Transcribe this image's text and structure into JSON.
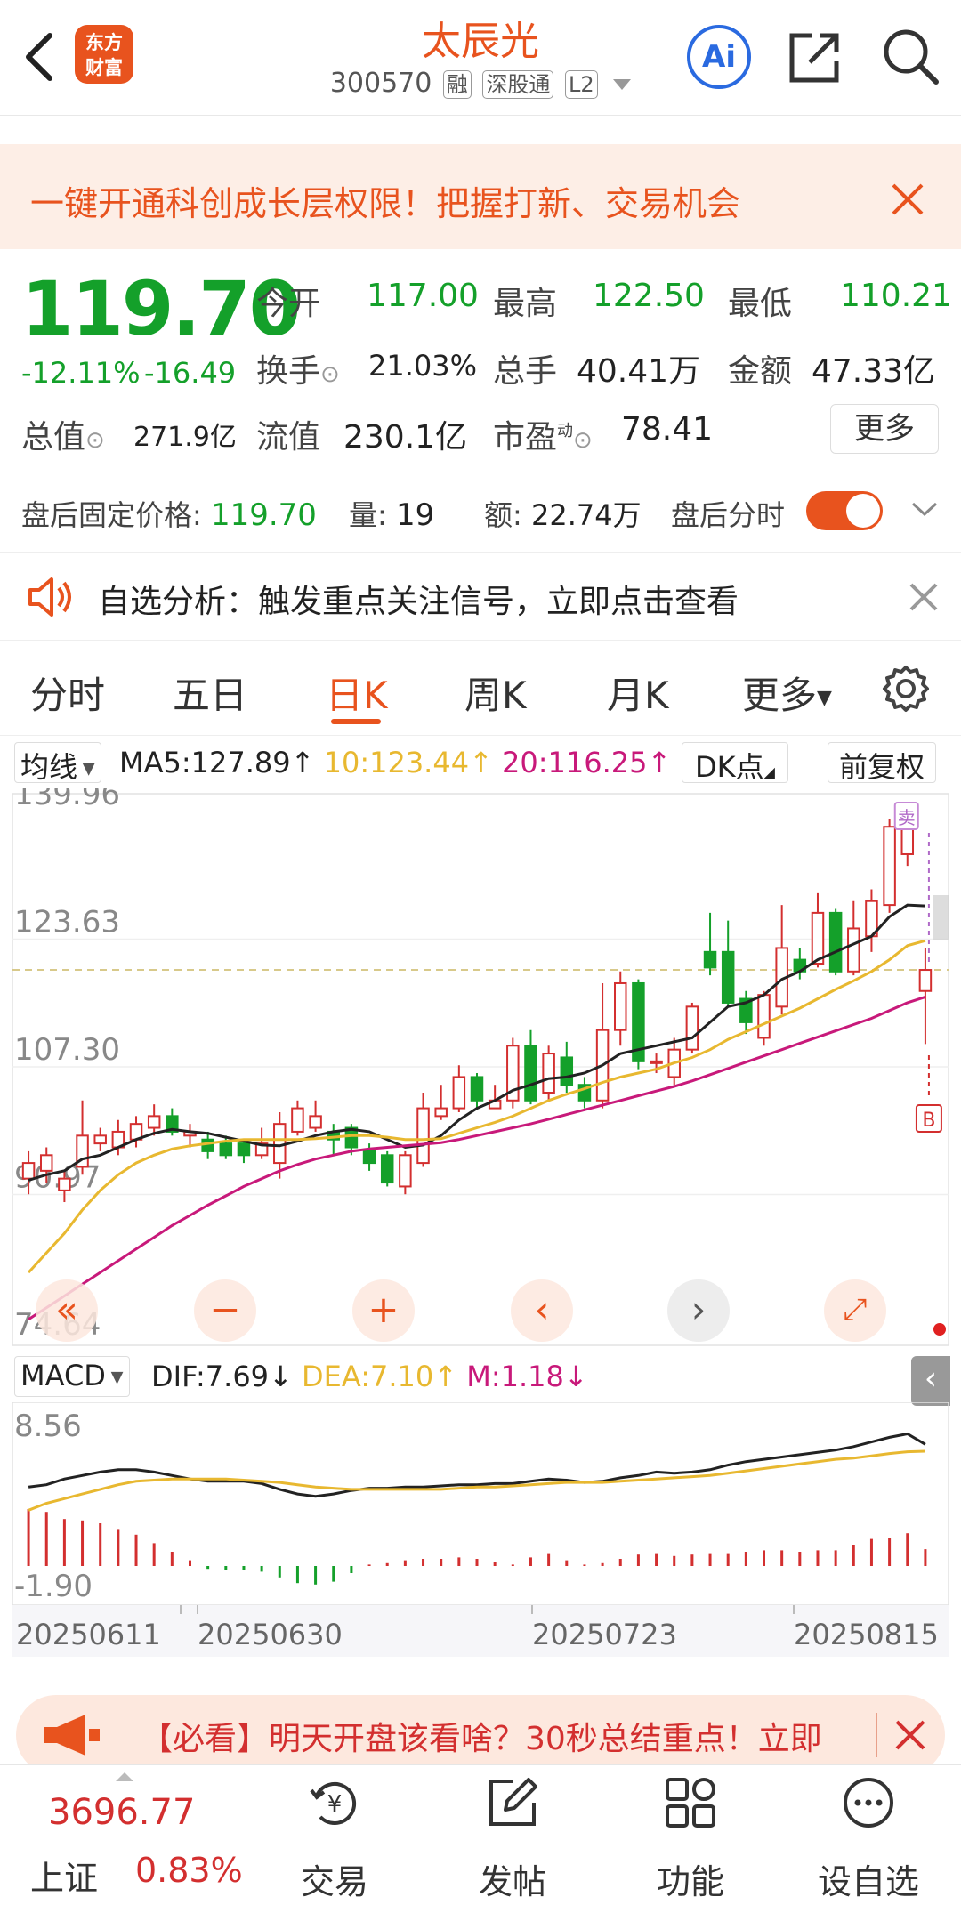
{
  "header": {
    "logo_line1": "东方",
    "logo_line2": "财富",
    "title": "太辰光",
    "code": "300570",
    "tags": [
      "融",
      "深股通",
      "L2"
    ],
    "ai_label": "Ai"
  },
  "banner": {
    "text": "一键开通科创成长层权限！把握打新、交易机会"
  },
  "quote": {
    "price": "119.70",
    "change_pct": "-12.11%",
    "change": "-16.49",
    "open_label": "今开",
    "open": "117.00",
    "high_label": "最高",
    "high": "122.50",
    "low_label": "最低",
    "low": "110.21",
    "turnover_label": "换手",
    "turnover": "21.03%",
    "volume_label": "总手",
    "volume": "40.41万",
    "amount_label": "金额",
    "amount": "47.33亿",
    "mktcap_label": "总值",
    "mktcap": "271.9亿",
    "float_label": "流值",
    "float_cap": "230.1亿",
    "pe_label": "市盈",
    "pe_sup": "动",
    "pe": "78.41",
    "more_label": "更多"
  },
  "after_hours": {
    "price_label": "盘后固定价格:",
    "price": "119.70",
    "vol_label": "量:",
    "vol": "19",
    "amt_label": "额:",
    "amt": "22.74万",
    "toggle_label": "盘后分时"
  },
  "notice": {
    "text": "自选分析：触发重点关注信号，立即点击查看"
  },
  "tabs": [
    "分时",
    "五日",
    "日K",
    "周K",
    "月K",
    "更多"
  ],
  "active_tab": 2,
  "ma_bar": {
    "selector": "均线",
    "ma5": "MA5:127.89↑",
    "ma10": "10:123.44↑",
    "ma20": "20:116.25↑",
    "dk": "DK点",
    "adjust": "前复权"
  },
  "macd_bar": {
    "selector": "MACD",
    "dif": "DIF:7.69↓",
    "dea": "DEA:7.10↑",
    "m": "M:1.18↓"
  },
  "colors": {
    "up": "#d32f2f",
    "down": "#14a02a",
    "accent": "#e8531e",
    "ma5": "#222222",
    "ma10": "#e8b830",
    "ma20": "#c8197a"
  },
  "chart_data": [
    {
      "type": "candlestick",
      "y_ticks": [
        "139.96",
        "123.63",
        "107.30",
        "90.97",
        "74.64"
      ],
      "ylim": [
        74.64,
        139.96
      ],
      "x_ticks": [
        "20250611",
        "20250630",
        "20250723",
        "20250815"
      ],
      "candles": [
        [
          93.0,
          95.0,
          91.0,
          96.5
        ],
        [
          94.0,
          96.0,
          92.5,
          97.0
        ],
        [
          91.5,
          93.0,
          90.0,
          94.0
        ],
        [
          94.5,
          98.5,
          93.5,
          103.0
        ],
        [
          97.5,
          98.5,
          96.5,
          99.5
        ],
        [
          97.0,
          99.0,
          96.0,
          100.5
        ],
        [
          98.0,
          100.0,
          97.0,
          101.0
        ],
        [
          99.5,
          101.0,
          98.5,
          102.5
        ],
        [
          101.0,
          99.0,
          98.5,
          102.0
        ],
        [
          98.5,
          99.0,
          97.0,
          100.0
        ],
        [
          98.0,
          96.5,
          95.5,
          99.0
        ],
        [
          97.5,
          96.0,
          95.5,
          98.5
        ],
        [
          97.5,
          96.0,
          95.0,
          98.0
        ],
        [
          96.0,
          97.5,
          95.5,
          99.5
        ],
        [
          95.0,
          100.0,
          93.0,
          101.5
        ],
        [
          99.0,
          102.0,
          98.5,
          103.0
        ],
        [
          99.5,
          101.0,
          99.0,
          103.0
        ],
        [
          99.0,
          98.0,
          96.0,
          100.0
        ],
        [
          99.5,
          97.0,
          96.0,
          100.0
        ],
        [
          96.5,
          95.0,
          94.0,
          97.5
        ],
        [
          96.0,
          92.5,
          92.0,
          96.5
        ],
        [
          92.0,
          96.0,
          91.0,
          96.5
        ],
        [
          95.0,
          102.0,
          94.5,
          104.0
        ],
        [
          101.0,
          102.0,
          100.5,
          105.0
        ],
        [
          102.0,
          106.0,
          101.5,
          107.5
        ],
        [
          106.0,
          103.0,
          102.0,
          106.5
        ],
        [
          102.0,
          103.0,
          102.0,
          105.0
        ],
        [
          103.0,
          110.0,
          102.0,
          111.0
        ],
        [
          110.0,
          103.0,
          102.5,
          112.0
        ],
        [
          104.0,
          109.0,
          103.0,
          110.0
        ],
        [
          108.5,
          105.0,
          104.0,
          110.5
        ],
        [
          105.0,
          103.0,
          102.0,
          106.0
        ],
        [
          103.0,
          112.0,
          102.0,
          118.0
        ],
        [
          112.0,
          118.0,
          110.0,
          119.5
        ],
        [
          118.0,
          108.0,
          107.0,
          118.5
        ],
        [
          108.0,
          108.0,
          106.5,
          109.0
        ],
        [
          106.0,
          109.5,
          105.0,
          111.0
        ],
        [
          109.5,
          115.0,
          109.0,
          115.5
        ],
        [
          122.0,
          120.0,
          119.0,
          127.0
        ],
        [
          122.0,
          115.5,
          115.0,
          126.0
        ],
        [
          116.0,
          113.0,
          111.5,
          117.0
        ],
        [
          111.0,
          116.5,
          110.0,
          117.0
        ],
        [
          115.0,
          122.5,
          114.0,
          128.0
        ],
        [
          121.0,
          119.5,
          118.5,
          122.5
        ],
        [
          120.5,
          127.0,
          120.0,
          129.5
        ],
        [
          127.0,
          119.5,
          119.0,
          127.5
        ],
        [
          119.5,
          125.0,
          119.0,
          128.5
        ],
        [
          124.0,
          128.5,
          122.0,
          130.0
        ],
        [
          128.0,
          138.0,
          127.0,
          139.0
        ],
        [
          134.5,
          138.5,
          133.0,
          141.0
        ],
        [
          117.0,
          119.7,
          110.21,
          122.5
        ]
      ],
      "ma_lines": {
        "ma5": [
          92.8,
          93.5,
          94.0,
          95.5,
          96.0,
          97.0,
          98.0,
          98.8,
          99.3,
          99.0,
          98.8,
          98.3,
          97.8,
          97.3,
          97.2,
          97.8,
          98.5,
          99.0,
          99.3,
          99.0,
          98.0,
          97.0,
          97.3,
          98.5,
          100.5,
          102.0,
          103.0,
          104.3,
          105.0,
          105.8,
          106.0,
          106.5,
          107.5,
          109.0,
          109.5,
          110.0,
          110.5,
          111.0,
          113.0,
          115.0,
          115.5,
          116.5,
          118.5,
          119.5,
          121.0,
          122.0,
          123.0,
          124.0,
          126.5,
          128.0,
          127.89
        ],
        "ma10": [
          81.0,
          83.5,
          86.0,
          89.0,
          91.5,
          93.5,
          95.0,
          96.0,
          96.8,
          97.2,
          97.5,
          97.8,
          98.0,
          98.0,
          98.0,
          98.0,
          98.1,
          98.3,
          98.5,
          98.5,
          98.3,
          98.0,
          98.0,
          98.1,
          98.8,
          99.5,
          100.2,
          101.0,
          102.0,
          103.0,
          103.8,
          104.5,
          105.3,
          106.0,
          106.5,
          107.0,
          107.8,
          108.5,
          109.5,
          110.8,
          111.8,
          112.8,
          113.8,
          114.8,
          116.0,
          117.2,
          118.3,
          119.5,
          121.0,
          122.8,
          123.44
        ],
        "ma20": [
          75.0,
          76.5,
          78.0,
          79.5,
          81.0,
          82.5,
          84.0,
          85.5,
          87.0,
          88.3,
          89.6,
          90.8,
          92.0,
          93.0,
          94.0,
          94.8,
          95.5,
          96.0,
          96.5,
          96.8,
          97.0,
          97.2,
          97.4,
          97.6,
          98.0,
          98.5,
          99.0,
          99.5,
          100.0,
          100.6,
          101.2,
          101.8,
          102.4,
          103.0,
          103.6,
          104.2,
          104.8,
          105.5,
          106.3,
          107.1,
          107.9,
          108.7,
          109.5,
          110.3,
          111.1,
          111.9,
          112.7,
          113.5,
          114.5,
          115.5,
          116.25
        ]
      },
      "reference_price": 119.7,
      "markers": [
        "B",
        "卖"
      ]
    },
    {
      "type": "bar+line",
      "y_ticks": [
        "8.56",
        "-1.90"
      ],
      "ylim": [
        -1.9,
        8.56
      ],
      "dif": [
        4.0,
        4.2,
        4.7,
        5.0,
        5.3,
        5.5,
        5.5,
        5.3,
        5.0,
        4.7,
        4.5,
        4.5,
        4.5,
        4.3,
        3.8,
        3.4,
        3.2,
        3.4,
        3.7,
        3.9,
        3.9,
        4.0,
        4.0,
        4.1,
        4.2,
        4.2,
        4.3,
        4.3,
        4.5,
        4.7,
        4.6,
        4.4,
        4.5,
        4.8,
        5.0,
        5.3,
        5.2,
        5.3,
        5.5,
        5.9,
        6.2,
        6.4,
        6.6,
        6.8,
        7.0,
        7.2,
        7.5,
        7.9,
        8.3,
        8.6,
        7.69
      ],
      "dea": [
        2.0,
        2.6,
        3.0,
        3.4,
        3.8,
        4.2,
        4.5,
        4.6,
        4.7,
        4.7,
        4.7,
        4.7,
        4.6,
        4.5,
        4.4,
        4.2,
        4.0,
        3.9,
        3.8,
        3.8,
        3.8,
        3.8,
        3.8,
        3.8,
        3.9,
        4.0,
        4.0,
        4.1,
        4.2,
        4.3,
        4.4,
        4.4,
        4.4,
        4.5,
        4.6,
        4.7,
        4.8,
        4.9,
        5.0,
        5.2,
        5.4,
        5.6,
        5.8,
        6.0,
        6.2,
        6.4,
        6.5,
        6.7,
        6.9,
        7.05,
        7.1
      ],
      "m": [
        4.0,
        3.8,
        3.3,
        3.2,
        3.0,
        2.6,
        2.2,
        1.6,
        1.0,
        0.4,
        -0.2,
        -0.3,
        -0.3,
        -0.4,
        -0.8,
        -1.2,
        -1.3,
        -1.1,
        -0.5,
        0.1,
        0.2,
        0.4,
        0.5,
        0.5,
        0.6,
        0.5,
        0.3,
        0.1,
        0.6,
        0.9,
        0.4,
        0.1,
        0.2,
        0.5,
        0.8,
        0.9,
        0.7,
        0.8,
        0.9,
        0.9,
        1.0,
        1.1,
        1.1,
        1.0,
        1.1,
        1.1,
        1.5,
        1.9,
        2.0,
        2.3,
        1.18
      ]
    }
  ],
  "ad": {
    "text": "【必看】明天开盘该看啥？30秒总结重点！立即"
  },
  "bottom_nav": {
    "index_name": "上证",
    "index_value": "3696.77",
    "index_pct": "0.83%",
    "items": [
      "交易",
      "发帖",
      "功能",
      "设自选"
    ]
  }
}
